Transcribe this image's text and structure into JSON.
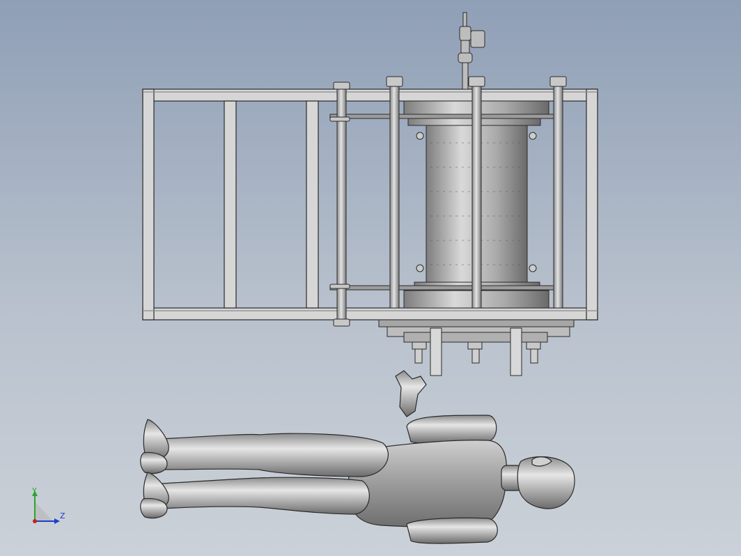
{
  "viewport": {
    "background_top": "#8f9fb6",
    "background_bottom": "#cbd1d8"
  },
  "model": {
    "body_color": "#9a9a9a",
    "edge_color": "#2a2a2a",
    "metal_color": "#b9b9b9"
  },
  "triad": {
    "y_label": "Y",
    "z_label": "Z",
    "y_color": "#2aa52a",
    "z_color": "#1f3cc8",
    "x_color": "#c81f1f"
  }
}
